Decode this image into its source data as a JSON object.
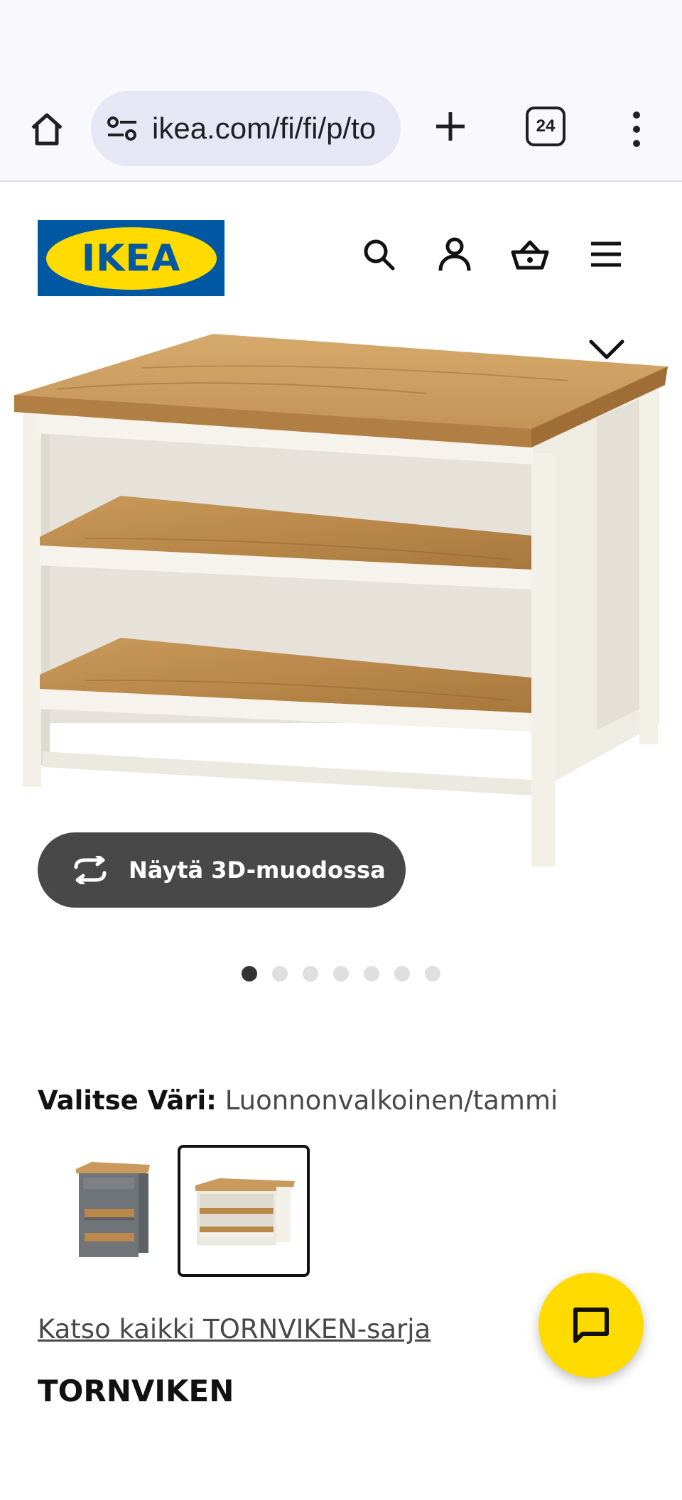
{
  "browser": {
    "url": "ikea.com/fi/fi/p/to",
    "tab_count": "24"
  },
  "header": {
    "logo_text": "IKEA",
    "icons": [
      "search-icon",
      "account-icon",
      "basket-icon",
      "hamburger-menu-icon"
    ]
  },
  "product_image": {
    "view_3d_label": "Näytä 3D-muodossa",
    "slide_count": 7,
    "active_slide": 1
  },
  "color_select": {
    "label": "Valitse Väri:",
    "value": "Luonnonvalkoinen/tammi",
    "options": [
      "grey-oak",
      "off-white-oak"
    ],
    "selected": 1
  },
  "series_link": "Katso kaikki TORNVIKEN-sarja",
  "product_name": "TORNVIKEN",
  "colors": {
    "ikea_blue": "#0058a3",
    "ikea_yellow": "#ffdb00",
    "button_dark": "#484848"
  }
}
